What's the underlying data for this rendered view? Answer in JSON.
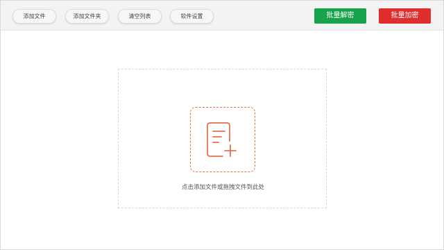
{
  "toolbar": {
    "add_file": "添加文件",
    "add_folder": "添加文件夹",
    "clear_list": "清空列表",
    "settings": "软件设置",
    "batch_decrypt": "批量解密",
    "batch_encrypt": "批量加密"
  },
  "colors": {
    "decrypt_green": "#17a34a",
    "encrypt_red": "#e02d2d",
    "accent_orange": "#e2704d"
  },
  "dropzone": {
    "icon": "add-document-icon",
    "hint": "点击添加文件或拖拽文件到此处"
  }
}
